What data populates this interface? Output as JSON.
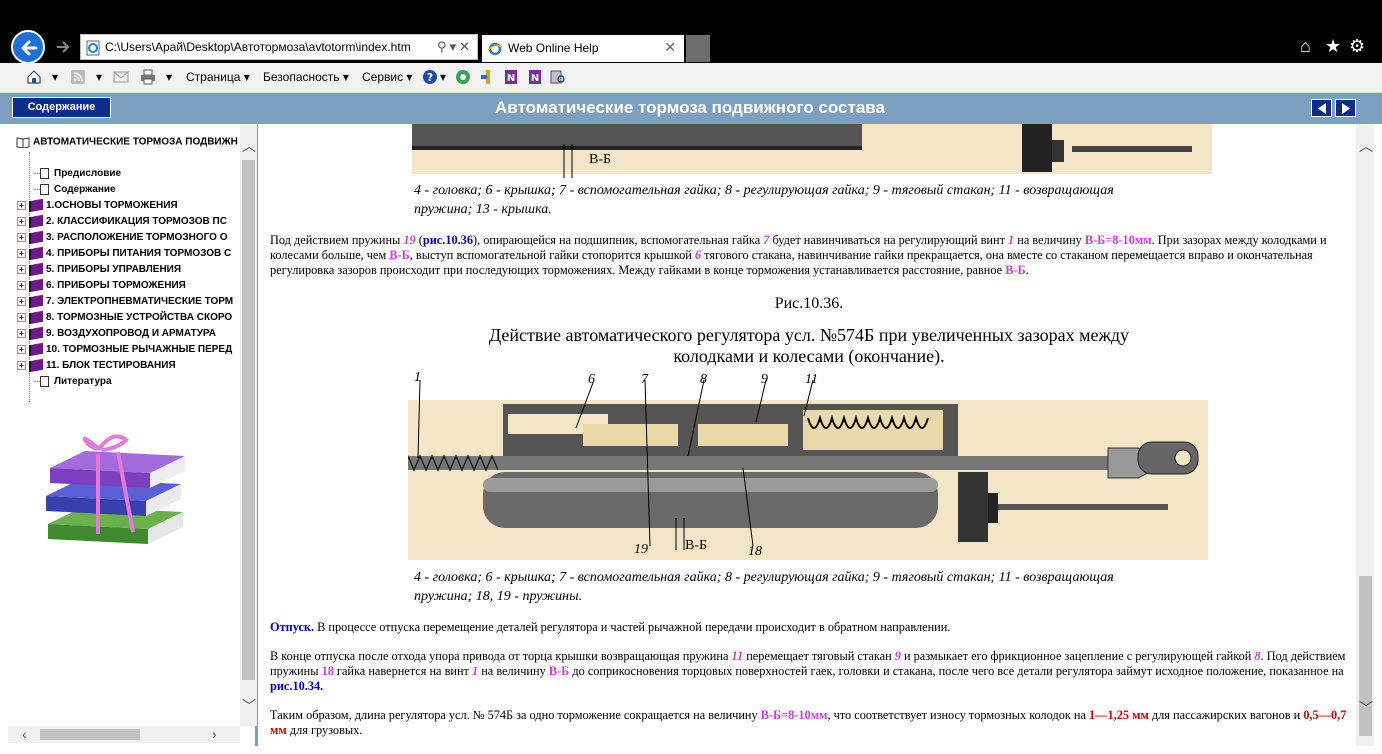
{
  "browser": {
    "address_url": "C:\\Users\\Арай\\Desktop\\Автотормоза\\avtotorm\\index.htm",
    "tab_title": "Web Online Help",
    "command_bar": {
      "page": "Страница",
      "safety": "Безопасность",
      "service": "Сервис"
    }
  },
  "help": {
    "toc_button": "Содержание",
    "title": "Автоматические тормоза подвижного состава"
  },
  "toc": {
    "root": "АВТОМАТИЧЕСКИЕ ТОРМОЗА ПОДВИЖН",
    "items": [
      {
        "label": "Предисловие",
        "kind": "page"
      },
      {
        "label": "Содержание",
        "kind": "page"
      },
      {
        "label": "1.ОСНОВЫ ТОРМОЖЕНИЯ",
        "kind": "book"
      },
      {
        "label": "2. КЛАССИФИКАЦИЯ ТОРМОЗОВ ПС",
        "kind": "book"
      },
      {
        "label": "3. РАСПОЛОЖЕНИЕ ТОРМОЗНОГО О",
        "kind": "book"
      },
      {
        "label": "4. ПРИБОРЫ ПИТАНИЯ ТОРМОЗОВ С",
        "kind": "book"
      },
      {
        "label": "5. ПРИБОРЫ УПРАВЛЕНИЯ",
        "kind": "book"
      },
      {
        "label": "6. ПРИБОРЫ ТОРМОЖЕНИЯ",
        "kind": "book"
      },
      {
        "label": "7. ЭЛЕКТРОПНЕВМАТИЧЕСКИЕ ТОРМ",
        "kind": "book"
      },
      {
        "label": "8. ТОРМОЗНЫЕ УСТРОЙСТВА СКОРО",
        "kind": "book"
      },
      {
        "label": "9. ВОЗДУХОПРОВОД И АРМАТУРА",
        "kind": "book"
      },
      {
        "label": "10. ТОРМОЗНЫЕ РЫЧАЖНЫЕ ПЕРЕД",
        "kind": "book"
      },
      {
        "label": "11. БЛОК ТЕСТИРОВАНИЯ",
        "kind": "book"
      },
      {
        "label": "Литература",
        "kind": "page"
      }
    ]
  },
  "content": {
    "fig1_gap_label": "В-Б",
    "fig1_caption_line1": "4 - головка; 6 - крышка; 7 - вспомогательная гайка; 8 - регулирующая гайка; 9 - тяговый стакан; 11 - возвращающая",
    "fig1_caption_line2": "пружина; 13 - крышка.",
    "p1": {
      "a": "Под действием пружины ",
      "n19": "19",
      "b": " (",
      "ref": "рис.10.36",
      "c": "), опирающейся на подшипник, вспомогательная гайка ",
      "n7": "7",
      "d": " будет навинчиваться на регулирующий винт ",
      "n1": "1",
      "e": " на величину ",
      "vb": "В-Б=8-10мм",
      "f": ". При зазорах между колодками и колесами больше, чем ",
      "vb2": "В-Б",
      "g": ", выступ вспомогательной гайки стопорится крышкой ",
      "n6": "6",
      "h": " тягового стакана, навинчивание гайки прекращается, она вместе со стаканом перемещается вправо и окончательная регулировка зазоров происходит при последующих торможениях. Между гайками в конце торможения устанавливается расстояние, равное ",
      "vb3": "В-Б",
      "i": "."
    },
    "fig2_number": "Рис.10.36.",
    "fig2_title_line1": "Действие автоматического регулятора усл. №574Б при увеличенных зазорах между",
    "fig2_title_line2": "колодками и колесами (окончание).",
    "fig2_labels": [
      "1",
      "6",
      "7",
      "8",
      "9",
      "11",
      "19",
      "В-Б",
      "18"
    ],
    "fig2_caption_line1": "4 - головка; 6 - крышка; 7 - вспомогательная гайка; 8 - регулирующая гайка; 9 - тяговый стакан; 11 - возвращающая",
    "fig2_caption_line2": "пружина; 18, 19 - пружины.",
    "p2": {
      "head": "Отпуск.",
      "body": " В процессе отпуска перемещение деталей регулятора и частей рычажной передачи происходит в обратном направлении."
    },
    "p3": {
      "a": "В конце отпуска после отхода упора привода от торца крышки возвращающая пружина ",
      "n11": "11",
      "b": " перемещает тяговый стакан ",
      "n9": "9",
      "c": " и размыкает его фрикционное зацепление с регулирующей гайкой ",
      "n8": "8",
      "d": ". Под действием пружины ",
      "n18": "18",
      "e": " гайка навернется на винт ",
      "n1": "1",
      "f": " на величину ",
      "vb": "В-Б",
      "g": " до соприкосновения торцовых поверхностей гаек, головки и стакана, после чего все детали регулятора займут исходное положение, показанное на ",
      "ref": "рис.10.34."
    },
    "p4": {
      "a": "Таким образом, длина регулятора усл. № 574Б за одно торможение сокращается на величину ",
      "vb": "В-Б=8-10мм",
      "b": ", что соответствует износу тормозных колодок на ",
      "r1": "1—1,25 мм",
      "c": " для пассажирских вагонов и ",
      "r2": "0,5—0,7 мм",
      "d": " для грузовых."
    }
  },
  "colors": {
    "help_bar": "#7d9fc2",
    "button_dark_blue": "#0d2c8c",
    "highlight_magenta": "#d23ce0",
    "link_blue": "#0000cc",
    "value_red": "#e00000"
  }
}
